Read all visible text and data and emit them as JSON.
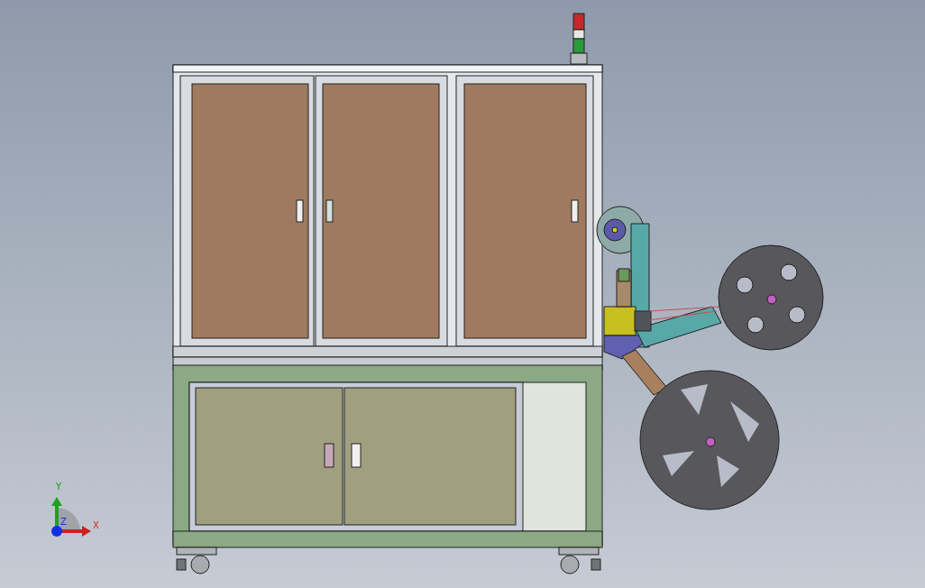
{
  "viewport": {
    "triad": {
      "axes": [
        {
          "label": "Y",
          "kind": "y"
        },
        {
          "label": "X",
          "kind": "x"
        },
        {
          "label": "Z",
          "kind": "z"
        }
      ]
    }
  }
}
